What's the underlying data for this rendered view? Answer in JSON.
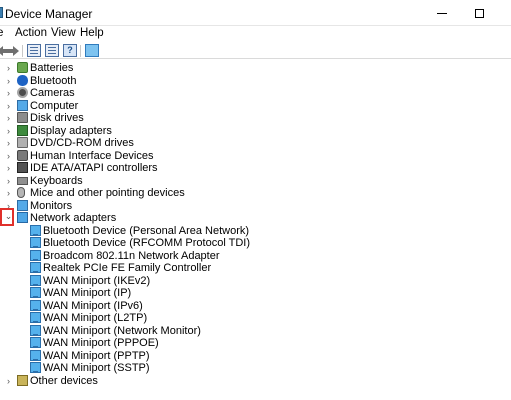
{
  "window": {
    "title": "Device Manager",
    "close_glyph": "✕"
  },
  "menu": [
    "e",
    "Action",
    "View",
    "Help"
  ],
  "toolbar": {
    "help_glyph": "?"
  },
  "tree": {
    "categories": [
      {
        "label": "Batteries",
        "icon": "battery-icon",
        "expanded": false
      },
      {
        "label": "Bluetooth",
        "icon": "bluetooth-icon",
        "expanded": false
      },
      {
        "label": "Cameras",
        "icon": "camera-icon",
        "expanded": false
      },
      {
        "label": "Computer",
        "icon": "computer-icon",
        "expanded": false
      },
      {
        "label": "Disk drives",
        "icon": "disk-drive-icon",
        "expanded": false
      },
      {
        "label": "Display adapters",
        "icon": "display-adapter-icon",
        "expanded": false
      },
      {
        "label": "DVD/CD-ROM drives",
        "icon": "dvd-drive-icon",
        "expanded": false
      },
      {
        "label": "Human Interface Devices",
        "icon": "hid-icon",
        "expanded": false
      },
      {
        "label": "IDE ATA/ATAPI controllers",
        "icon": "ide-controller-icon",
        "expanded": false
      },
      {
        "label": "Keyboards",
        "icon": "keyboard-icon",
        "expanded": false
      },
      {
        "label": "Mice and other pointing devices",
        "icon": "mouse-icon",
        "expanded": false
      },
      {
        "label": "Monitors",
        "icon": "monitor-icon",
        "expanded": false
      },
      {
        "label": "Network adapters",
        "icon": "network-adapter-icon",
        "expanded": true
      },
      {
        "label": "Other devices",
        "icon": "other-devices-icon",
        "expanded": false
      }
    ],
    "network_adapters": [
      "Bluetooth Device (Personal Area Network)",
      "Bluetooth Device (RFCOMM Protocol TDI)",
      "Broadcom 802.11n Network Adapter",
      "Realtek PCIe FE Family Controller",
      "WAN Miniport (IKEv2)",
      "WAN Miniport (IP)",
      "WAN Miniport (IPv6)",
      "WAN Miniport (L2TP)",
      "WAN Miniport (Network Monitor)",
      "WAN Miniport (PPPOE)",
      "WAN Miniport (PPTP)",
      "WAN Miniport (SSTP)"
    ],
    "chevron_collapsed": "›",
    "chevron_expanded": "⌄"
  },
  "colors": {
    "highlight_border": "#e0302b",
    "selection": "#cce8ff"
  }
}
